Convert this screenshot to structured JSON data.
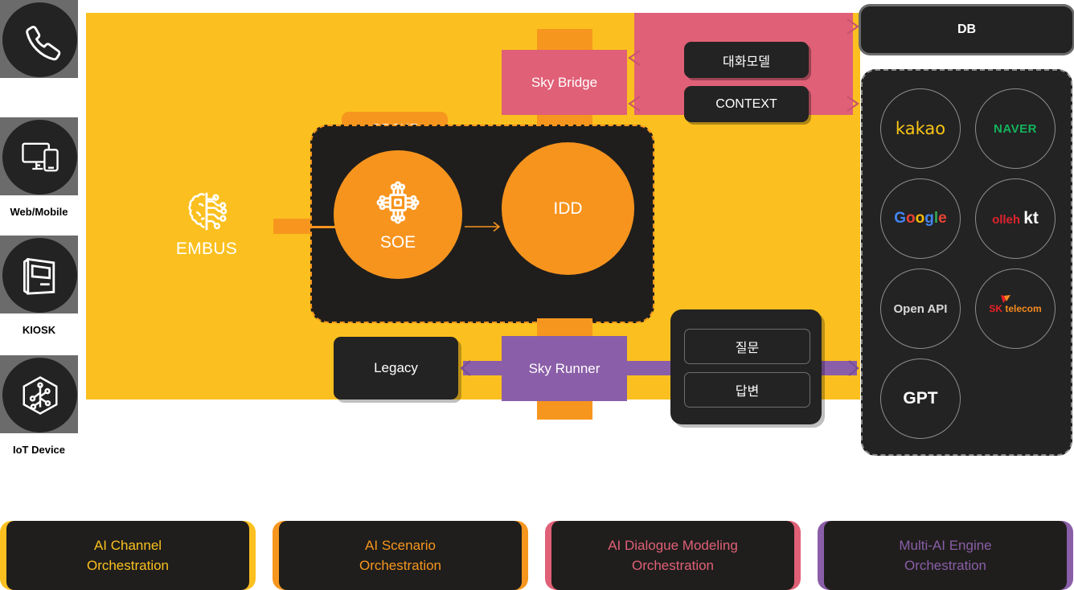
{
  "channels": [
    {
      "label": "",
      "icon": "phone-icon"
    },
    {
      "label": "Web/Mobile",
      "icon": "desktop-mobile-icon"
    },
    {
      "label": "KIOSK",
      "icon": "kiosk-icon"
    },
    {
      "label": "IoT Device",
      "icon": "iot-device-icon"
    }
  ],
  "embus": {
    "label": "EMBUS",
    "icon": "ai-brain-icon"
  },
  "orche": {
    "tab_label": "ORCHE",
    "soe_label": "SOE",
    "soe_icon": "cpu-chip-icon",
    "idd_label": "IDD"
  },
  "sky_bridge": {
    "label": "Sky Bridge"
  },
  "sky_runner": {
    "label": "Sky Runner"
  },
  "legacy": {
    "label": "Legacy"
  },
  "dialogue": {
    "model_label": "대화모델",
    "context_label": "CONTEXT"
  },
  "qa": {
    "question_label": "질문",
    "answer_label": "답변"
  },
  "db": {
    "label": "DB"
  },
  "engines": [
    {
      "name": "kakao",
      "label": "kakao"
    },
    {
      "name": "naver",
      "label": "NAVER"
    },
    {
      "name": "google",
      "label": "Google"
    },
    {
      "name": "kt",
      "label": "olleh kt"
    },
    {
      "name": "open-api",
      "label": "Open API"
    },
    {
      "name": "sk-telecom",
      "label": "SK telecom"
    },
    {
      "name": "gpt",
      "label": "GPT"
    }
  ],
  "legend": [
    {
      "line1": "AI Channel",
      "line2": "Orchestration",
      "color": "#FBC01F"
    },
    {
      "line1": "AI Scenario",
      "line2": "Orchestration",
      "color": "#F7961E"
    },
    {
      "line1": "AI Dialogue Modeling",
      "line2": "Orchestration",
      "color": "#E06077"
    },
    {
      "line1": "Multi-AI Engine",
      "line2": "Orchestration",
      "color": "#8A5EA8"
    }
  ],
  "colors": {
    "yellow": "#FBC01F",
    "orange": "#F7961E",
    "pink": "#E06077",
    "purple": "#8A5EA8",
    "dark": "#1F1E1C",
    "dark_box": "#232323"
  }
}
